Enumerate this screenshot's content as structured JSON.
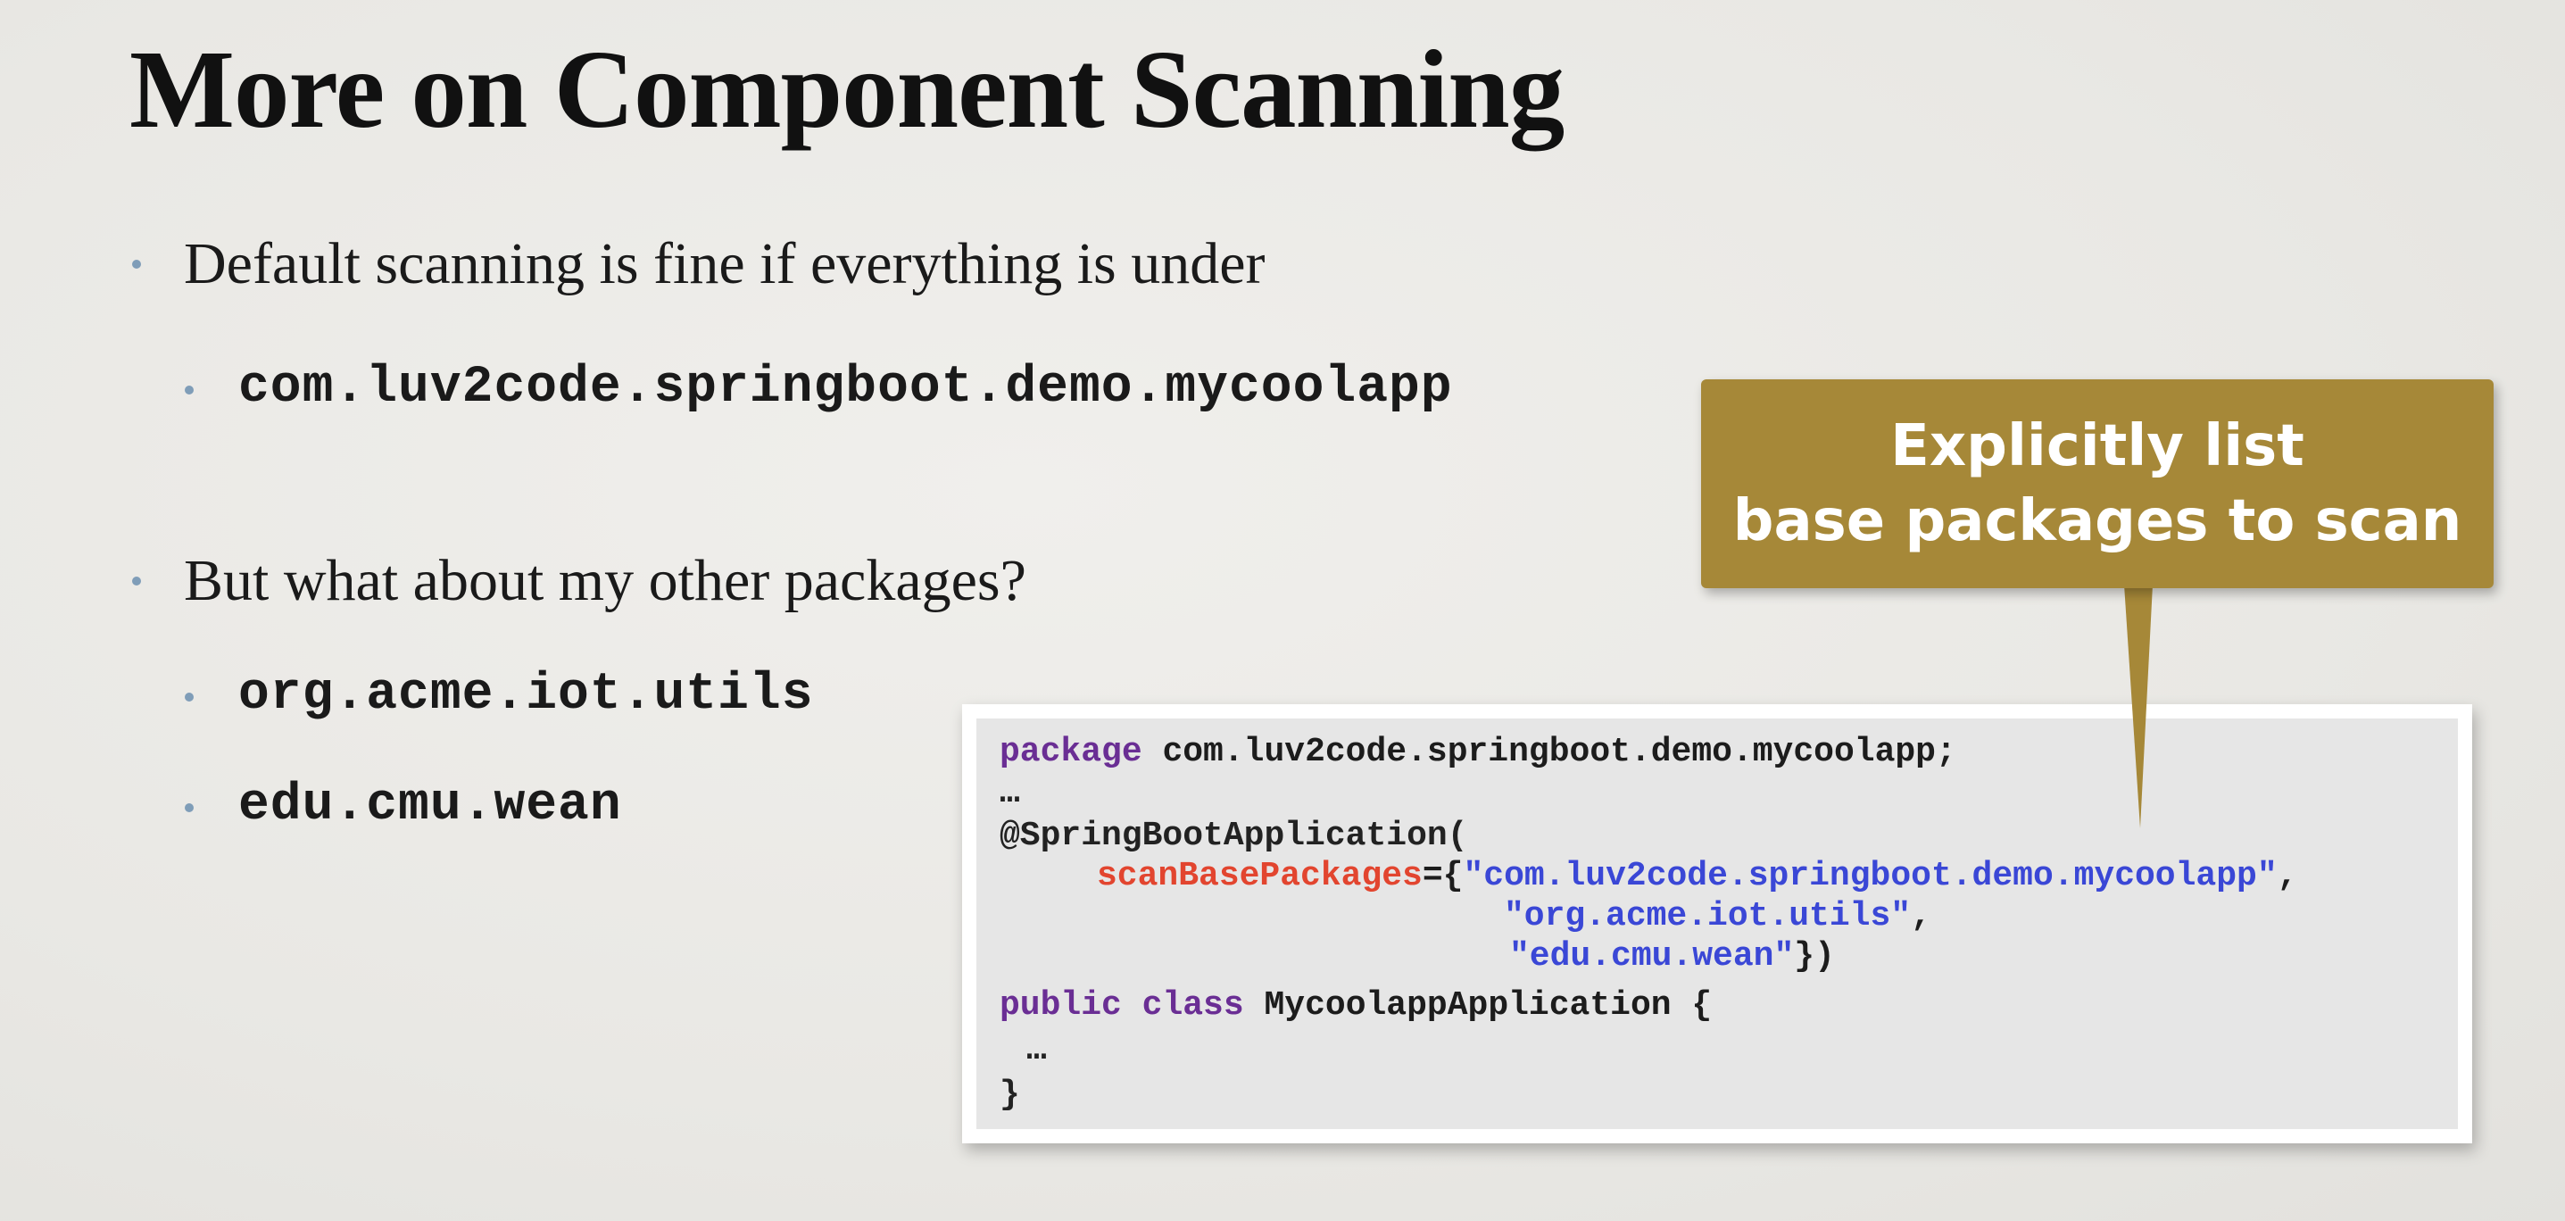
{
  "slide": {
    "title": "More on Component Scanning",
    "bullets": {
      "b1": "Default scanning is fine if everything is under",
      "b1_sub": "com.luv2code.springboot.demo.mycoolapp",
      "b2": "But what about my other packages?",
      "b2_sub1": "org.acme.iot.utils",
      "b2_sub2": "edu.cmu.wean"
    },
    "callout": {
      "line1": "Explicitly list",
      "line2": "base packages to scan"
    },
    "code": {
      "l1_kw": "package",
      "l1_rest": " com.luv2code.springboot.demo.mycoolapp;",
      "l2": "…",
      "l3": "@SpringBootApplication(",
      "l4_indent": "   ",
      "l4_attr": "scanBasePackages",
      "l4_eq": "={",
      "l4_str": "\"com.luv2code.springboot.demo.mycoolapp\"",
      "l4_end": ",",
      "l5_str": "\"org.acme.iot.utils\"",
      "l5_end": ",",
      "l6_str": "\"edu.cmu.wean\"",
      "l6_end": "})",
      "l7_kw1": "public",
      "l7_sp": " ",
      "l7_kw2": "class",
      "l7_rest": " MycoolappApplication {",
      "l8": "…",
      "l9": "}"
    }
  },
  "colors": {
    "background": "#eceae6",
    "bullet": "#7f9db8",
    "callout": "#a68838",
    "keyword": "#6a2e94",
    "attribute": "#e2452f",
    "string": "#3a47d6"
  }
}
